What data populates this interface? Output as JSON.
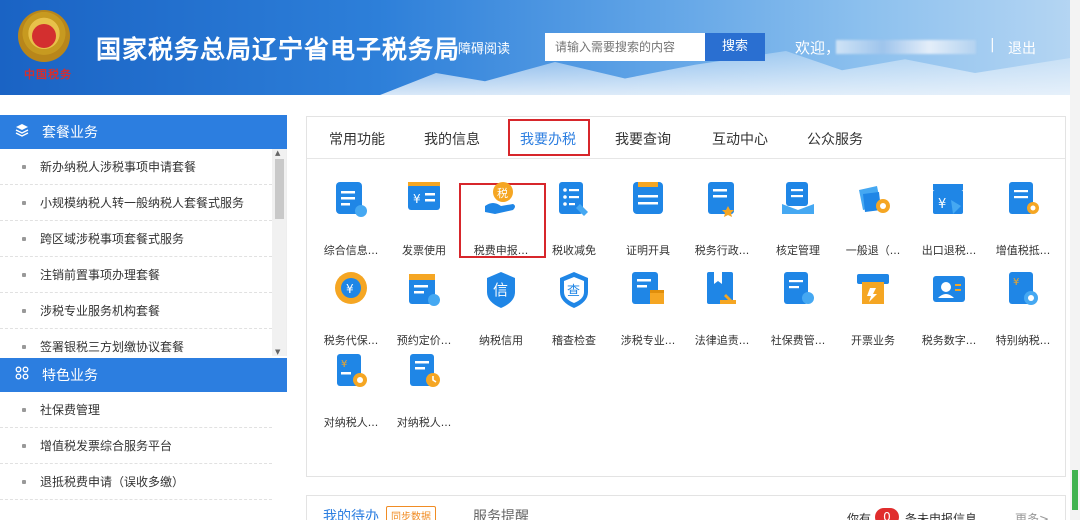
{
  "header": {
    "seal_text": "中国税务",
    "title": "国家税务总局辽宁省电子税务局",
    "accessibility": "障碍阅读",
    "search_placeholder": "请输入需要搜索的内容",
    "search_button": "搜索",
    "welcome": "欢迎，",
    "separator": "|",
    "logout": "退出"
  },
  "sidebar": {
    "section1": {
      "icon": "layers-icon",
      "title": "套餐业务"
    },
    "items1": [
      "新办纳税人涉税事项申请套餐",
      "小规模纳税人转一般纳税人套餐式服务",
      "跨区域涉税事项套餐式服务",
      "注销前置事项办理套餐",
      "涉税专业服务机构套餐",
      "签署银税三方划缴协议套餐"
    ],
    "section2": {
      "icon": "grid-icon",
      "title": "特色业务"
    },
    "items2": [
      "社保费管理",
      "增值税发票综合服务平台",
      "退抵税费申请（误收多缴）"
    ]
  },
  "tabs": [
    "常用功能",
    "我的信息",
    "我要办税",
    "我要查询",
    "互动中心",
    "公众服务"
  ],
  "active_tab": "我要办税",
  "tiles": [
    {
      "label": "综合信息...",
      "icon": "document-info-icon"
    },
    {
      "label": "发票使用",
      "icon": "invoice-icon"
    },
    {
      "label": "税费申报...",
      "icon": "tax-declaration-icon"
    },
    {
      "label": "税收减免",
      "icon": "tax-reduction-icon"
    },
    {
      "label": "证明开具",
      "icon": "certificate-icon"
    },
    {
      "label": "税务行政...",
      "icon": "tax-admin-icon"
    },
    {
      "label": "核定管理",
      "icon": "approval-icon"
    },
    {
      "label": "一般退（...",
      "icon": "refund-icon"
    },
    {
      "label": "出口退税...",
      "icon": "export-refund-icon"
    },
    {
      "label": "增值税抵...",
      "icon": "vat-deduction-icon"
    },
    {
      "label": "税务代保...",
      "icon": "tax-custody-icon"
    },
    {
      "label": "预约定价...",
      "icon": "pricing-calendar-icon"
    },
    {
      "label": "纳税信用",
      "icon": "credit-icon",
      "glyph": "信"
    },
    {
      "label": "稽查检查",
      "icon": "inspection-icon",
      "glyph": "查"
    },
    {
      "label": "涉税专业...",
      "icon": "tax-professional-icon"
    },
    {
      "label": "法律追责...",
      "icon": "legal-icon"
    },
    {
      "label": "社保费管...",
      "icon": "social-security-icon"
    },
    {
      "label": "开票业务",
      "icon": "issue-invoice-icon"
    },
    {
      "label": "税务数字...",
      "icon": "digital-account-icon"
    },
    {
      "label": "特别纳税...",
      "icon": "special-tax-icon"
    },
    {
      "label": "对纳税人...",
      "icon": "taxpayer-yen-icon"
    },
    {
      "label": "对纳税人...",
      "icon": "taxpayer-doc-icon"
    }
  ],
  "bottom": {
    "todo": "我的待办",
    "sync": "同步数据",
    "remind": "服务提醒",
    "have": "你有",
    "count": "0",
    "unreported": "条未申报信息",
    "more": "更多>"
  },
  "colors": {
    "brand_blue": "#2c7ee0",
    "icon_blue": "#1f86e6",
    "icon_orange": "#f5a623",
    "highlight_red": "#d7262b"
  }
}
